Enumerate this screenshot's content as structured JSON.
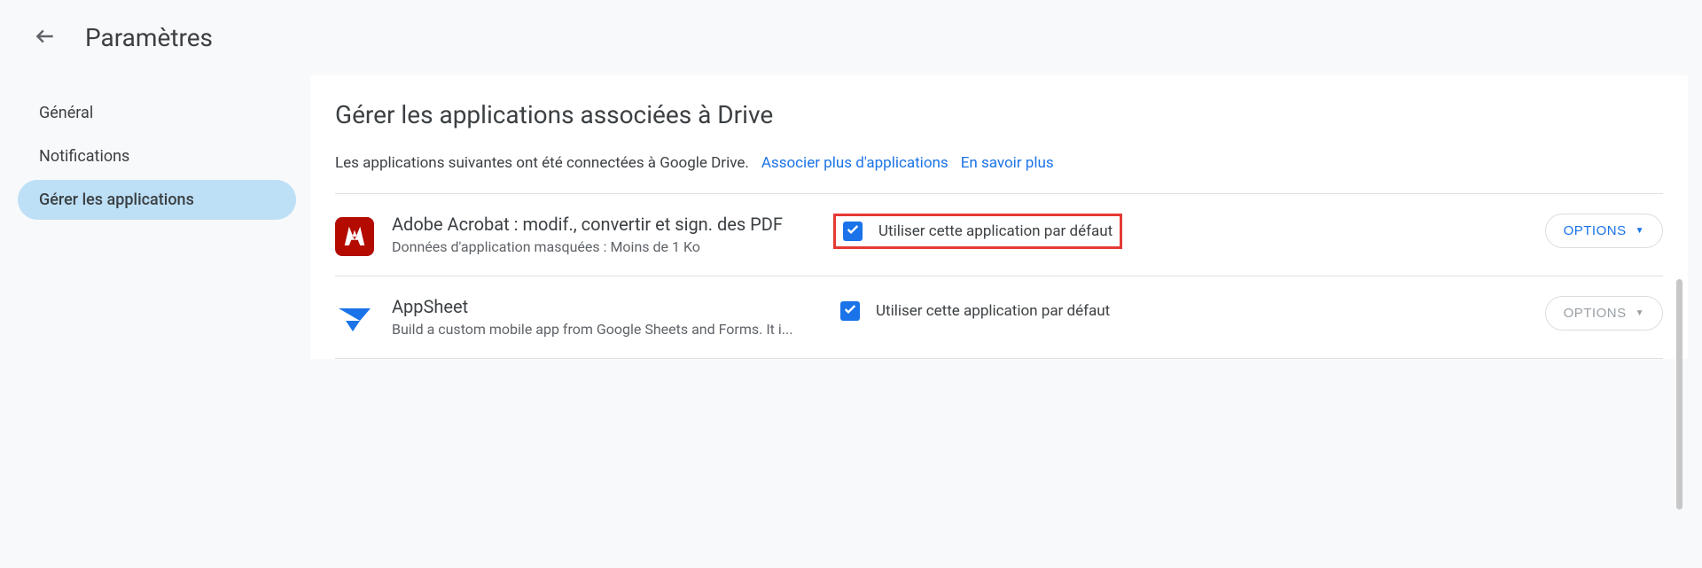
{
  "header": {
    "title": "Paramètres"
  },
  "sidebar": {
    "items": [
      {
        "label": "Général",
        "selected": false
      },
      {
        "label": "Notifications",
        "selected": false
      },
      {
        "label": "Gérer les applications",
        "selected": true
      }
    ]
  },
  "content": {
    "title": "Gérer les applications associées à Drive",
    "description": "Les applications suivantes ont été connectées à Google Drive.",
    "link_connect": "Associer plus d'applications",
    "link_learn": "En savoir plus"
  },
  "apps": [
    {
      "icon": "adobe-acrobat-icon",
      "name": "Adobe Acrobat : modif., convertir et sign. des PDF",
      "subtitle": "Données d'application masquées : Moins de 1 Ko",
      "default_checked": true,
      "default_label": "Utiliser cette application par défaut",
      "options_label": "OPTIONS",
      "options_enabled": true,
      "highlighted": true
    },
    {
      "icon": "appsheet-icon",
      "name": "AppSheet",
      "subtitle": "Build a custom mobile app from Google Sheets and Forms. It i...",
      "default_checked": true,
      "default_label": "Utiliser cette application par défaut",
      "options_label": "OPTIONS",
      "options_enabled": false,
      "highlighted": false
    }
  ]
}
